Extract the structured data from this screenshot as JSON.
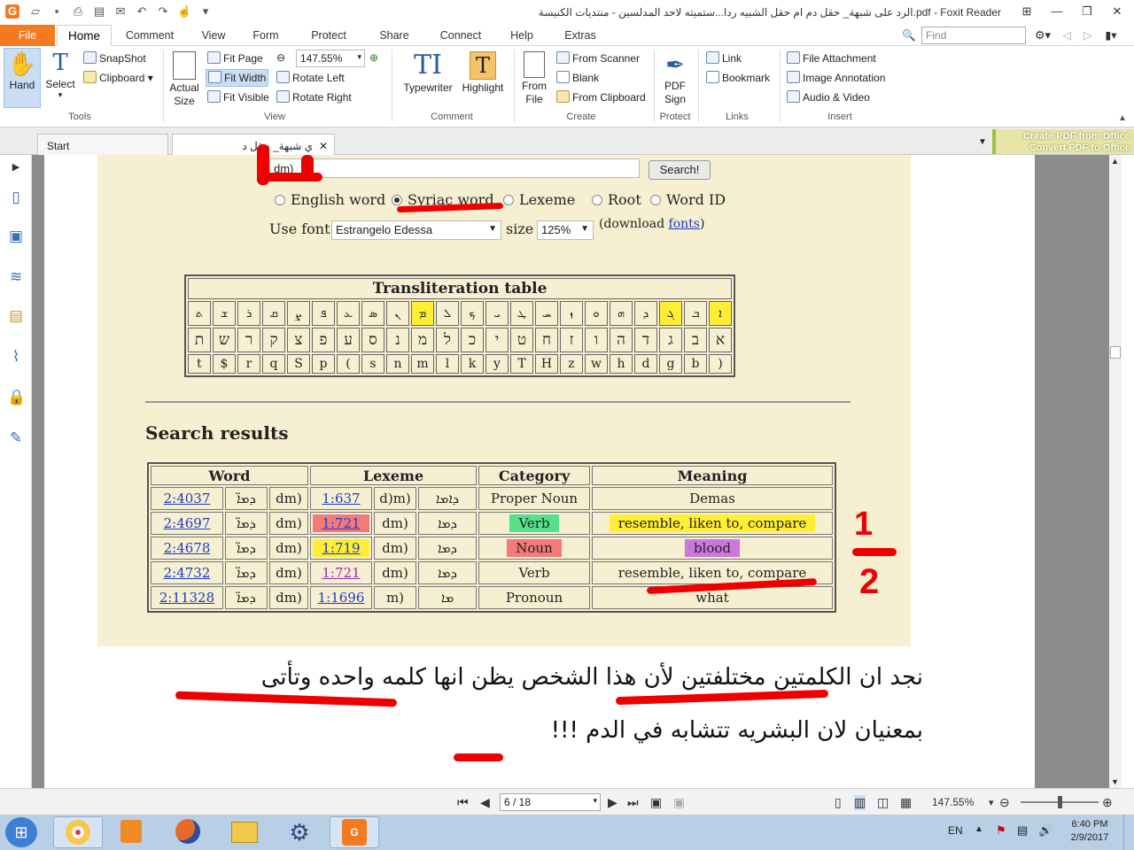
{
  "window": {
    "title": "الرد على شبهة_ حقل دم ام حقل الشبيه ردا...ستميته لاحد المدلسين - منتديات الكنيسة.pdf - Foxit Reader",
    "app_icon": "foxit-icon"
  },
  "menu": {
    "tabs": [
      "File",
      "Home",
      "Comment",
      "View",
      "Form",
      "Protect",
      "Share",
      "Connect",
      "Help",
      "Extras"
    ],
    "active": "Home",
    "find_placeholder": "Find"
  },
  "ribbon": {
    "tools": {
      "hand": "Hand",
      "select": "Select",
      "snapshot": "SnapShot",
      "clipboard": "Clipboard",
      "group": "Tools"
    },
    "view": {
      "actual_size_1": "Actual",
      "actual_size_2": "Size",
      "fit_page": "Fit Page",
      "fit_width": "Fit Width",
      "fit_visible": "Fit Visible",
      "zoom": "147.55%",
      "rotate_left": "Rotate Left",
      "rotate_right": "Rotate Right",
      "group": "View"
    },
    "comment": {
      "typewriter": "Typewriter",
      "highlight": "Highlight",
      "group": "Comment"
    },
    "create": {
      "from_file_1": "From",
      "from_file_2": "File",
      "from_scanner": "From Scanner",
      "blank": "Blank",
      "from_clipboard": "From Clipboard",
      "group": "Create"
    },
    "protect": {
      "pdf_sign_1": "PDF",
      "pdf_sign_2": "Sign",
      "group": "Protect"
    },
    "links": {
      "link": "Link",
      "bookmark": "Bookmark",
      "group": "Links"
    },
    "insert": {
      "file_attachment": "File Attachment",
      "image_annotation": "Image Annotation",
      "audio_video": "Audio & Video",
      "group": "Insert"
    }
  },
  "doc_tabs": {
    "start": "Start",
    "current": "ي شبهة_ حقل د",
    "ad_line1": "Create PDF from Office",
    "ad_line2": "Convert PDF to Office"
  },
  "web": {
    "search_value": "dm)",
    "search_button": "Search!",
    "radios": [
      "English word",
      "Syriac word",
      "Lexeme",
      "Root",
      "Word ID"
    ],
    "radio_selected": "Syriac word",
    "use_font_label": "Use font",
    "font_value": "Estrangelo Edessa",
    "size_label": "size",
    "size_value": "125%",
    "download_prefix": "(download ",
    "download_link": "fonts",
    "download_suffix": ")",
    "translit_title": "Transliteration table",
    "translit_syriac": [
      "ܬ",
      "ܫ",
      "ܪ",
      "ܩ",
      "ܨ",
      "ܦ",
      "ܥ",
      "ܣ",
      "ܢ",
      "ܡ",
      "ܠ",
      "ܟ",
      "ܝ",
      "ܛ",
      "ܚ",
      "ܙ",
      "ܘ",
      "ܗ",
      "ܕ",
      "ܓ",
      "ܒ",
      "ܐ"
    ],
    "translit_hebrew": [
      "ת",
      "ש",
      "ר",
      "ק",
      "צ",
      "פ",
      "ע",
      "ס",
      "נ",
      "מ",
      "ל",
      "כ",
      "י",
      "ט",
      "ח",
      "ז",
      "ו",
      "ה",
      "ד",
      "ג",
      "ב",
      "א"
    ],
    "translit_latin": [
      "t",
      "$",
      "r",
      "q",
      "S",
      "p",
      "(",
      "s",
      "n",
      "m",
      "l",
      "k",
      "y",
      "T",
      "H",
      "z",
      "w",
      "h",
      "d",
      "g",
      "b",
      ")"
    ],
    "results_title": "Search results",
    "results_headers": [
      "Word",
      "Lexeme",
      "Category",
      "Meaning"
    ],
    "results_rows": [
      {
        "id": "2:4037",
        "syr": "ܕܡܐ̈",
        "word": "dm)",
        "lex": "1:637",
        "lexw": "d)m)",
        "lexsyr": "ܕܐܡܐ",
        "cat": "Proper Noun",
        "mean": "Demas"
      },
      {
        "id": "2:4697",
        "syr": "ܕܡܐ̈",
        "word": "dm)",
        "lex": "1:721",
        "lexw": "dm)",
        "lexsyr": "ܕܡܐ",
        "cat": "Verb",
        "mean": "resemble, liken to, compare"
      },
      {
        "id": "2:4678",
        "syr": "ܕܡܐ̈",
        "word": "dm)",
        "lex": "1:719",
        "lexw": "dm)",
        "lexsyr": "ܕܡܐ",
        "cat": "Noun",
        "mean": "blood"
      },
      {
        "id": "2:4732",
        "syr": "ܕܡܐ̈",
        "word": "dm)",
        "lex": "1:721",
        "lexw": "dm)",
        "lexsyr": "ܕܡܐ",
        "cat": "Verb",
        "mean": "resemble, liken to, compare"
      },
      {
        "id": "2:11328",
        "syr": "ܕܡܐ̈",
        "word": "dm)",
        "lex": "1:1696",
        "lexw": "m)",
        "lexsyr": "ܡܐ",
        "cat": "Pronoun",
        "mean": "what"
      }
    ],
    "annotation_1": "1",
    "annotation_2": "2"
  },
  "arabic": {
    "line1": "نجد ان الكلمتين مختلفتين لأن هذا الشخص يظن انها كلمه واحده وتأتى",
    "line2": "بمعنيان لان البشريه تتشابه في الدم !!!"
  },
  "navbar": {
    "page": "6 / 18",
    "zoom": "147.55%"
  },
  "taskbar": {
    "lang": "EN",
    "time": "6:40 PM",
    "date": "2/9/2017"
  },
  "colors": {
    "accent_orange": "#f47a20",
    "highlight_yellow": "#ffee33",
    "highlight_green": "#55e089",
    "highlight_red": "#f47a7a",
    "highlight_purple": "#cc77dd",
    "annotation_red": "#ee0000"
  }
}
